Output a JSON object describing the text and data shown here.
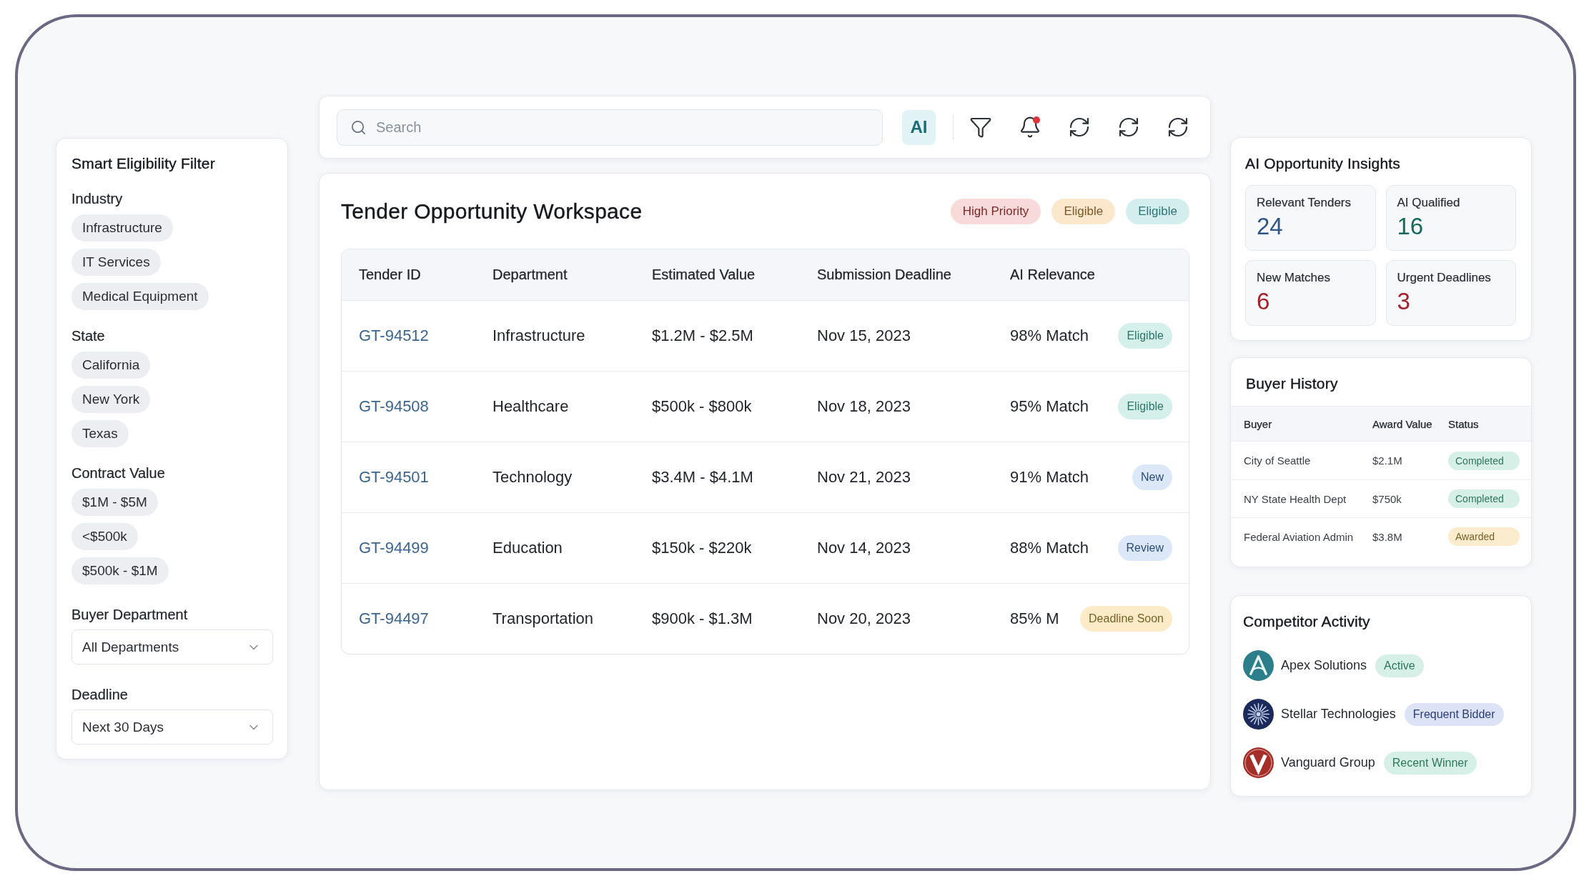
{
  "filter_panel": {
    "title": "Smart Eligibility Filter",
    "groups": [
      {
        "kind": "chips",
        "label": "Industry",
        "options": [
          "Infrastructure",
          "IT Services",
          "Medical Equipment"
        ]
      },
      {
        "kind": "chips",
        "label": "State",
        "options": [
          "California",
          "New York",
          "Texas"
        ]
      },
      {
        "kind": "chips",
        "label": "Contract Value",
        "options": [
          "$1M - $5M",
          "<$500k",
          "$500k - $1M"
        ]
      },
      {
        "kind": "select",
        "label": "Buyer Department",
        "value": "All Departments"
      },
      {
        "kind": "select",
        "label": "Deadline",
        "value": "Next 30 Days"
      }
    ]
  },
  "toolbar": {
    "search": {
      "placeholder": "Search"
    },
    "ai_button": {
      "label": "AI"
    },
    "notifications": {
      "unread": true
    }
  },
  "workspace": {
    "title": "Tender Opportunity Workspace",
    "tags": [
      {
        "label": "High Priority",
        "color": "#f8dada"
      },
      {
        "label": "Eligible",
        "color": "#fbe7cb"
      },
      {
        "label": "Eligible",
        "color": "#d4eeee"
      }
    ],
    "table": {
      "columns": [
        "Tender ID",
        "Department",
        "Estimated Value",
        "Submission Deadline",
        "AI Relevance"
      ],
      "rows": [
        {
          "tender_id": "GT-94512",
          "department": "Infrastructure",
          "estimated_value": "$1.2M - $2.5M",
          "deadline": "Nov 15, 2023",
          "relevance": "98% Match",
          "status": {
            "label": "Eligible",
            "color": "#d5efea"
          }
        },
        {
          "tender_id": "GT-94508",
          "department": "Healthcare",
          "estimated_value": "$500k - $800k",
          "deadline": "Nov 18, 2023",
          "relevance": "95% Match",
          "status": {
            "label": "Eligible",
            "color": "#d5efea"
          }
        },
        {
          "tender_id": "GT-94501",
          "department": "Technology",
          "estimated_value": "$3.4M - $4.1M",
          "deadline": "Nov 21, 2023",
          "relevance": "91% Match",
          "status": {
            "label": "New",
            "color": "#dce8f7"
          }
        },
        {
          "tender_id": "GT-94499",
          "department": "Education",
          "estimated_value": "$150k - $220k",
          "deadline": "Nov 14, 2023",
          "relevance": "88% Match",
          "status": {
            "label": "Review",
            "color": "#dce8f7"
          }
        },
        {
          "tender_id": "GT-94497",
          "department": "Transportation",
          "estimated_value": "$900k - $1.3M",
          "deadline": "Nov 20, 2023",
          "relevance": "85% M",
          "status": {
            "label": "Deadline Soon",
            "color": "#fcebc7"
          }
        }
      ]
    }
  },
  "insights": {
    "title": "AI Opportunity Insights",
    "stats": [
      {
        "label": "Relevant Tenders",
        "value": "24",
        "color": "#2f5687"
      },
      {
        "label": "AI Qualified",
        "value": "16",
        "color": "#17695f"
      },
      {
        "label": "New Matches",
        "value": "6",
        "color": "#a3222c"
      },
      {
        "label": "Urgent Deadlines",
        "value": "3",
        "color": "#a3222c"
      }
    ]
  },
  "buyer_history": {
    "title": "Buyer History",
    "columns": [
      "Buyer",
      "Award Value",
      "Status"
    ],
    "rows": [
      {
        "buyer": "City of Seattle",
        "award_value": "$2.1M",
        "status": {
          "label": "Completed",
          "color": "#d7f0e7"
        }
      },
      {
        "buyer": "NY State Health Dept",
        "award_value": "$750k",
        "status": {
          "label": "Completed",
          "color": "#d7f0e7"
        }
      },
      {
        "buyer": "Federal Aviation Admin",
        "award_value": "$3.8M",
        "status": {
          "label": "Awarded",
          "color": "#fbeccd"
        }
      }
    ]
  },
  "competitors": {
    "title": "Competitor Activity",
    "items": [
      {
        "name": "Apex Solutions",
        "logo": {
          "kind": "peak"
        },
        "status": {
          "label": "Active",
          "color": "#d7f0e7"
        }
      },
      {
        "name": "Stellar Technologies",
        "logo": {
          "kind": "starburst"
        },
        "status": {
          "label": "Frequent Bidder",
          "color": "#dde3f7"
        }
      },
      {
        "name": "Vanguard Group",
        "logo": {
          "kind": "chevron"
        },
        "status": {
          "label": "Recent Winner",
          "color": "#d7f0e7"
        }
      }
    ]
  }
}
